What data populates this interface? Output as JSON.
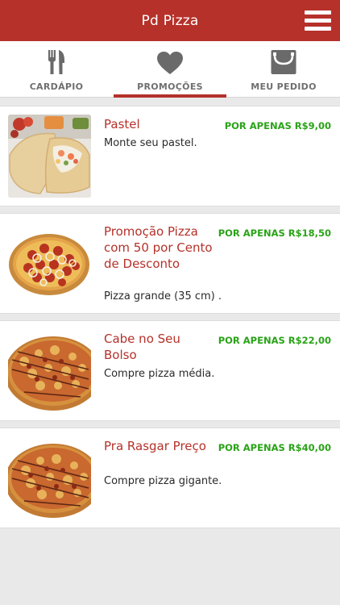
{
  "header": {
    "title": "Pd Pizza",
    "menu_icon": "hamburger-menu-icon"
  },
  "tabs": [
    {
      "label": "CARDÁPIO",
      "icon": "fork-knife-icon",
      "active": false
    },
    {
      "label": "PROMOÇÕES",
      "icon": "heart-icon",
      "active": true
    },
    {
      "label": "MEU PEDIDO",
      "icon": "shopping-bag-icon",
      "active": false
    }
  ],
  "colors": {
    "brand": "#b5312a",
    "price": "#2aa318",
    "background": "#e9e9ea"
  },
  "promotions": [
    {
      "title": "Pastel",
      "description": "Monte seu pastel.",
      "price": "POR APENAS R$9,00",
      "image": "pastel-photo"
    },
    {
      "title": "Promoção Pizza com 50 por Cento de Desconto",
      "description": "Pizza grande (35 cm) .",
      "price": "POR APENAS R$18,50",
      "image": "pepperoni-pizza-photo"
    },
    {
      "title": "Cabe no Seu Bolso",
      "description": "Compre pizza média.",
      "price": "POR APENAS R$22,00",
      "image": "bbq-pizza-photo"
    },
    {
      "title": "Pra Rasgar Preço",
      "description": "Compre pizza gigante.",
      "price": "POR APENAS R$40,00",
      "image": "bbq-pizza-photo"
    }
  ]
}
